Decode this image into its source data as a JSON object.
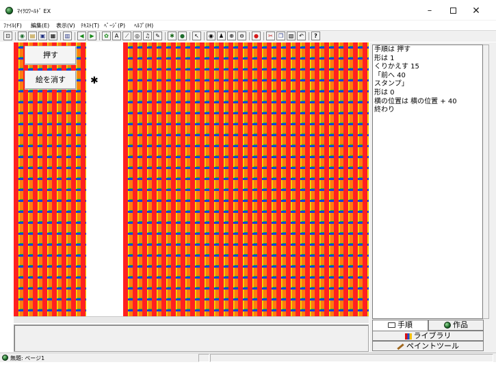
{
  "window": {
    "title": "ﾏｲｸﾛﾜｰﾙﾄﾞ EX",
    "minimize_glyph": "–",
    "close_glyph": "✕"
  },
  "menu": [
    {
      "label": "ﾌｧｲﾙ(F)"
    },
    {
      "label": "編集(E)"
    },
    {
      "label": "表示(V)"
    },
    {
      "label": "ﾃｷｽﾄ(T)"
    },
    {
      "label": "ﾍﾟｰｼﾞ(P)"
    },
    {
      "label": "ﾍﾙﾌﾟ(H)"
    }
  ],
  "toolbar": {
    "buttons": [
      {
        "icon": "pin-icon",
        "glyph": "⊡"
      },
      {
        "icon": "new-world-icon",
        "glyph": "◉"
      },
      {
        "icon": "open-folder-icon",
        "glyph": "▤"
      },
      {
        "icon": "save-icon",
        "glyph": "▣"
      },
      {
        "icon": "print-icon",
        "glyph": "▦"
      },
      {
        "icon": "grid-icon",
        "glyph": "▥"
      },
      {
        "icon": "arrow-left-icon",
        "glyph": "◀"
      },
      {
        "icon": "arrow-right-icon",
        "glyph": "▶"
      },
      {
        "icon": "turtle-icon",
        "glyph": "✿"
      },
      {
        "icon": "text-icon",
        "glyph": "A"
      },
      {
        "icon": "line-icon",
        "glyph": "⟋"
      },
      {
        "icon": "eye-icon",
        "glyph": "◎"
      },
      {
        "icon": "music-icon",
        "glyph": "♫"
      },
      {
        "icon": "draw-icon",
        "glyph": "✎"
      },
      {
        "icon": "bug-icon",
        "glyph": "✱"
      },
      {
        "icon": "globe-icon",
        "glyph": "●"
      },
      {
        "icon": "pointer-icon",
        "glyph": "↖"
      },
      {
        "icon": "view-icon",
        "glyph": "◉"
      },
      {
        "icon": "stamp-icon",
        "glyph": "♟"
      },
      {
        "icon": "zoom-in-icon",
        "glyph": "⊕"
      },
      {
        "icon": "zoom-out-icon",
        "glyph": "⊖"
      },
      {
        "icon": "stop-icon",
        "glyph": "●"
      },
      {
        "icon": "cut-icon",
        "glyph": "✂"
      },
      {
        "icon": "copy-icon",
        "glyph": "❐"
      },
      {
        "icon": "paste-icon",
        "glyph": "▧"
      },
      {
        "icon": "undo-icon",
        "glyph": "↶"
      },
      {
        "icon": "help-icon",
        "glyph": "?"
      }
    ],
    "colors": {
      "globe": "#1d6d2c",
      "stop": "#d41a1a",
      "arrow": "#1a8a1a"
    }
  },
  "stage": {
    "push_button": "押す",
    "erase_button": "絵を消す",
    "turtle_glyph": "✱",
    "pattern_colors": [
      "#ff2020",
      "#ff7a10",
      "#f0f000",
      "#19c81a",
      "#1640e0"
    ]
  },
  "procedure": {
    "lines": [
      "手順は 押す",
      "形は 1",
      "くりかえす 15",
      "「前へ 40",
      "スタンプ」",
      "形は 0",
      "横の位置は 横の位置 + 40",
      "終わり"
    ]
  },
  "panel": {
    "tab_procedure": "手順",
    "tab_works": "作品",
    "library_button": "ライブラリ",
    "paint_tool_button": "ペイントツール"
  },
  "status": {
    "text": "無題: ページ1"
  }
}
